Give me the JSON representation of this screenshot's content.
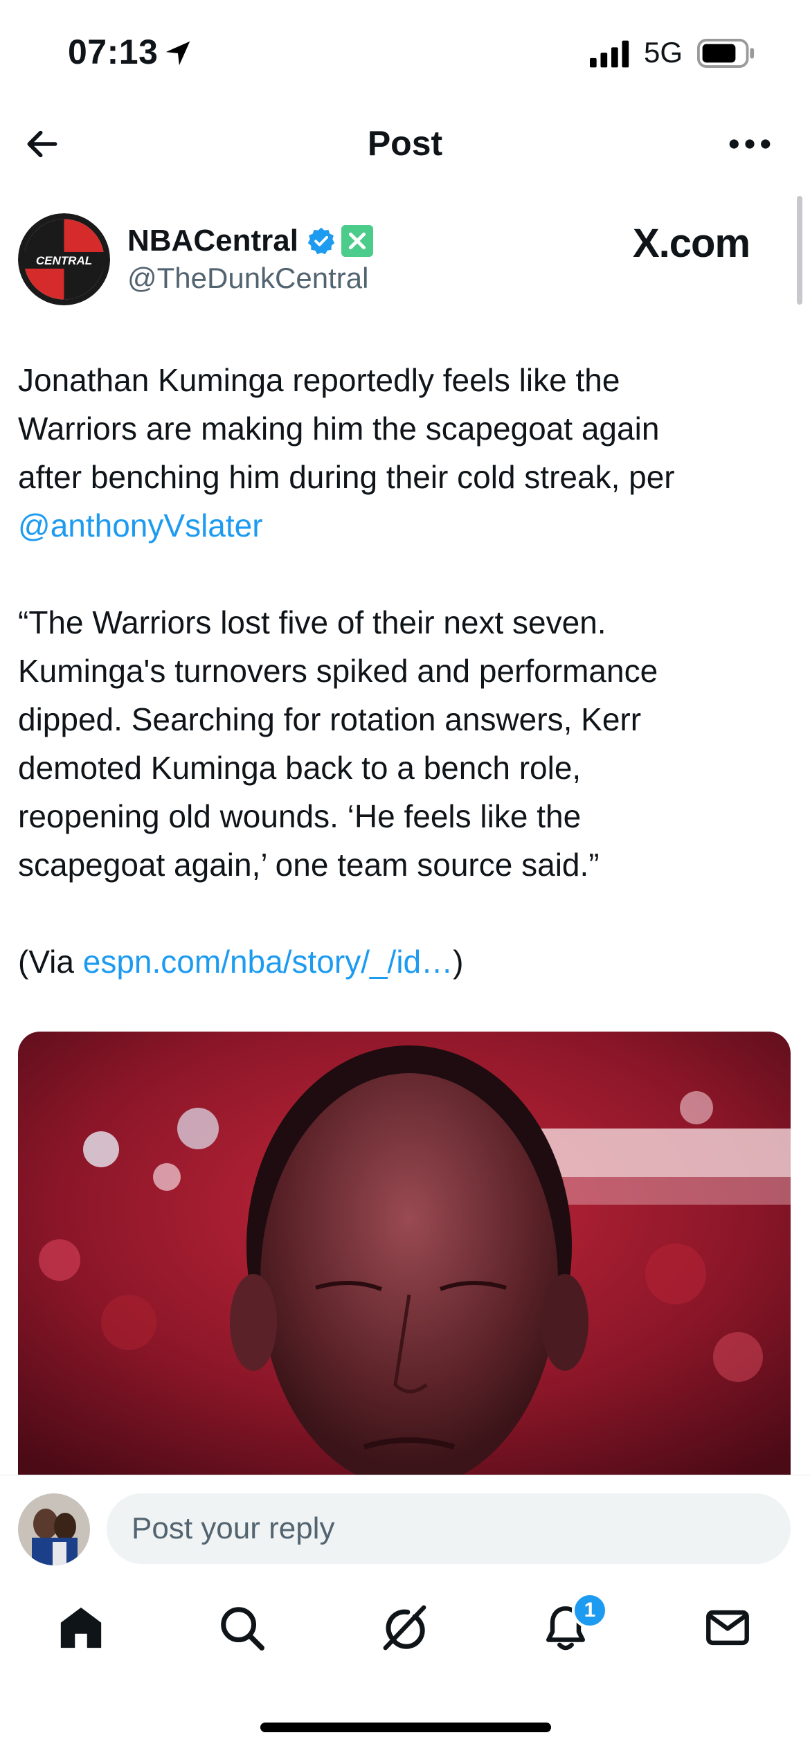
{
  "status_bar": {
    "time": "07:13",
    "network": "5G",
    "icons": [
      "location-arrow-icon",
      "signal-icon",
      "battery-icon"
    ]
  },
  "header": {
    "title": "Post",
    "back_icon": "arrow-left-icon",
    "more_icon": "more-horizontal-icon"
  },
  "post": {
    "author_name": "NBACentral",
    "author_handle": "@TheDunkCentral",
    "avatar_text": "CENTRAL",
    "source_label": "X.com",
    "lines": [
      "Jonathan Kuminga reportedly feels like the",
      "Warriors are making him the scapegoat again",
      "after benching him during their cold streak, per"
    ],
    "mention": "@anthonyVslater",
    "quote_lines": [
      "“The Warriors lost five of their next seven.",
      "Kuminga's turnovers spiked and performance",
      "dipped. Searching for rotation answers, Kerr",
      "demoted Kuminga back to a bench role,",
      "reopening old wounds. ‘He feels like the",
      "scapegoat again,’ one team source said.”"
    ],
    "via_prefix": "(Via ",
    "via_link": "espn.com/nba/story/_/id…",
    "via_suffix": ")"
  },
  "reply": {
    "placeholder": "Post your reply"
  },
  "tab_bar": {
    "items": [
      "home-icon",
      "search-icon",
      "grok-icon",
      "notifications-icon",
      "messages-icon"
    ],
    "notification_count": "1"
  },
  "colors": {
    "accent": "#1d9bf0",
    "text": "#0f1419",
    "secondary_text": "#536471",
    "input_bg": "#eff3f4"
  }
}
